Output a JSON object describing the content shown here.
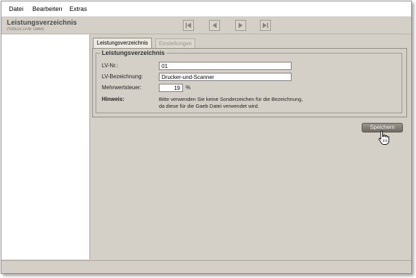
{
  "menu": {
    "items": [
      "Datei",
      "Bearbeiten",
      "Extras"
    ]
  },
  "header": {
    "title": "Leistungsverzeichnis",
    "subtitle": "(TOOLLV, LV-ID: 14454)"
  },
  "nav": {
    "first_icon": "first-page-icon",
    "prev_icon": "previous-icon",
    "next_icon": "next-icon",
    "last_icon": "last-page-icon"
  },
  "tabs": [
    {
      "label": "Leistungsverzeichnis",
      "active": true
    },
    {
      "label": "Einstellungen",
      "active": false
    }
  ],
  "form": {
    "legend": "Leistungsverzeichnis",
    "lv_nr_label": "LV-Nr.:",
    "lv_nr_value": "01",
    "lv_bez_label": "LV-Bezeichnung:",
    "lv_bez_value": "Drucker-und-Scanner",
    "mwst_label": "Mehrwertsteuer:",
    "mwst_value": "19",
    "mwst_unit": "%",
    "hint_label": "Hinweis:",
    "hint_line1": "Bitte verwenden Sie keine Sonderzeichen für die Bezeichnung,",
    "hint_line2": "da diese für die Gaeb Datei verwendet wird."
  },
  "actions": {
    "save_label": "Speichern",
    "cursor_icon": "hand-pointer-icon"
  },
  "colors": {
    "background": "#d4d0c8",
    "save_button": "#8a867e"
  }
}
